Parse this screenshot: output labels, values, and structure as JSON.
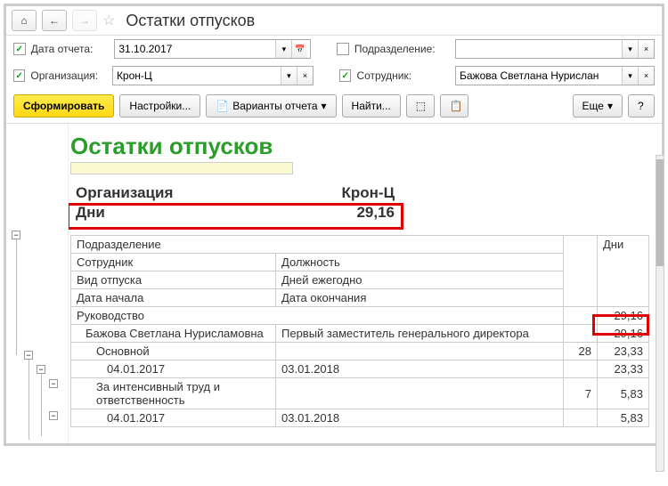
{
  "title": "Остатки отпусков",
  "filters": {
    "date": {
      "label": "Дата отчета:",
      "value": "31.10.2017",
      "checked": true
    },
    "org": {
      "label": "Организация:",
      "value": "Крон-Ц",
      "checked": true
    },
    "div": {
      "label": "Подразделение:",
      "value": "",
      "checked": false
    },
    "emp": {
      "label": "Сотрудник:",
      "value": "Бажова Светлана Нурислан",
      "checked": true
    }
  },
  "actions": {
    "form": "Сформировать",
    "settings": "Настройки...",
    "variants": "Варианты отчета",
    "find": "Найти...",
    "more": "Еще",
    "help": "?"
  },
  "report": {
    "title": "Остатки отпусков",
    "summary": {
      "org_label": "Организация",
      "org_value": "Крон-Ц",
      "days_label": "Дни",
      "days_value": "29,16"
    },
    "headers": {
      "division": "Подразделение",
      "employee": "Сотрудник",
      "position": "Должность",
      "leave_type": "Вид отпуска",
      "days_yearly": "Дней ежегодно",
      "start": "Дата начала",
      "end": "Дата окончания",
      "group": "Руководство",
      "days": "Дни"
    },
    "group_days": "29,16",
    "rows": [
      {
        "indent": 1,
        "c1": "Бажова Светлана Нурисламовна",
        "c2": "Первый заместитель генерального директора",
        "n1": "",
        "days": "29,16"
      },
      {
        "indent": 2,
        "c1": "Основной",
        "c2": "",
        "n1": "28",
        "days": "23,33"
      },
      {
        "indent": 3,
        "c1": "04.01.2017",
        "c2": "03.01.2018",
        "n1": "",
        "days": "23,33"
      },
      {
        "indent": 2,
        "c1": "За интенсивный труд и ответственность",
        "c2": "",
        "n1": "7",
        "days": "5,83"
      },
      {
        "indent": 3,
        "c1": "04.01.2017",
        "c2": "03.01.2018",
        "n1": "",
        "days": "5,83"
      }
    ]
  }
}
